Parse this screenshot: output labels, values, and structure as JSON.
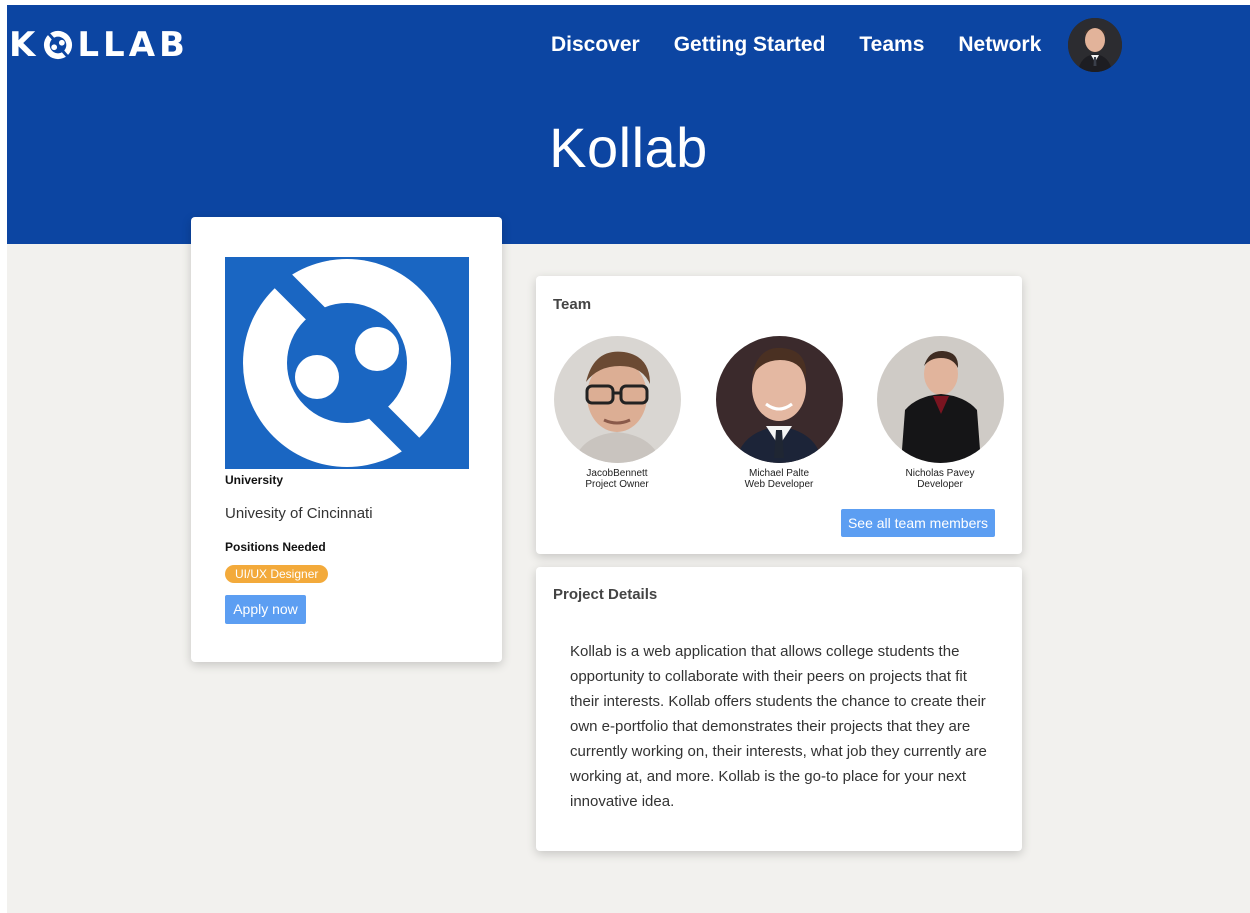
{
  "brand": {
    "letters_left": "K",
    "letters_right": "LLAB",
    "icon": "kollab-logo-icon"
  },
  "nav": {
    "items": [
      {
        "label": "Discover"
      },
      {
        "label": "Getting Started"
      },
      {
        "label": "Teams"
      },
      {
        "label": "Network"
      }
    ],
    "avatar_icon": "user-avatar"
  },
  "hero": {
    "title": "Kollab",
    "background": "#0c45a2"
  },
  "project": {
    "logo_icon": "kollab-logo-icon",
    "university_label": "University",
    "university_value": "Univesity of Cincinnati",
    "positions_label": "Positions Needed",
    "positions": [
      "UI/UX Designer"
    ],
    "apply_label": "Apply now"
  },
  "team": {
    "title": "Team",
    "members": [
      {
        "name": "JacobBennett",
        "role": "Project Owner"
      },
      {
        "name": "Michael Palte",
        "role": "Web Developer"
      },
      {
        "name": "Nicholas Pavey",
        "role": "Developer"
      }
    ],
    "see_all_label": "See all team members"
  },
  "details": {
    "title": "Project Details",
    "description": "Kollab is a web application that allows college students the opportunity to collaborate with their peers on projects that fit their interests. Kollab offers students the chance to create their own e-portfolio that demonstrates their projects that they are currently working on, their interests, what job they currently are working at, and more. Kollab is the go-to place for your next innovative idea."
  },
  "colors": {
    "accent": "#5c9ef2",
    "badge": "#f3aa3b",
    "page_bg": "#f2f1ee"
  }
}
